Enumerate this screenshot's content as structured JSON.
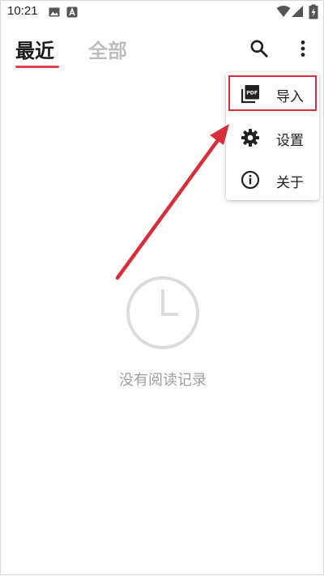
{
  "status_bar": {
    "time": "10:21",
    "left_icons": [
      "image-icon",
      "accessibility-icon"
    ],
    "right_icons": [
      "wifi-icon",
      "signal-icon",
      "battery-charging-icon"
    ]
  },
  "tabs": [
    {
      "label": "最近",
      "active": true
    },
    {
      "label": "全部",
      "active": false
    }
  ],
  "toolbar": {
    "icons": [
      "search-icon",
      "more-vert-icon"
    ]
  },
  "menu": {
    "items": [
      {
        "label": "导入",
        "icon": "pdf-import-icon"
      },
      {
        "label": "设置",
        "icon": "gear-icon"
      },
      {
        "label": "关于",
        "icon": "info-icon"
      }
    ]
  },
  "empty_state": {
    "icon": "clock-icon",
    "text": "没有阅读记录"
  },
  "colors": {
    "accent": "#e2404a",
    "annotation": "#d62e3a",
    "inactive_tab": "#bdbdbd",
    "empty_text": "#9e9e9e"
  }
}
